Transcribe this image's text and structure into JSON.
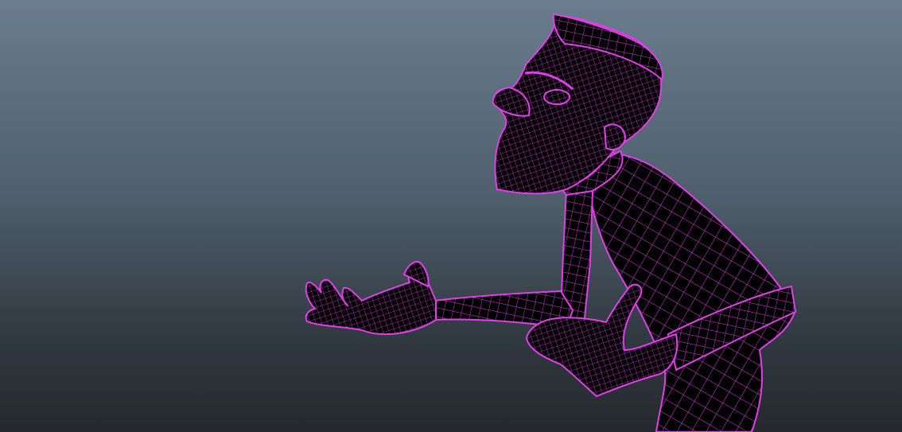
{
  "viewport": {
    "background_top": "#6a7d8e",
    "background_bottom": "#25292d",
    "wire_color": "#e040e8",
    "fill_color": "#000000",
    "display_mode": "wireframe-on-shaded"
  },
  "scene": {
    "subject": "character-mesh",
    "pose": "leaning-forward-gesturing"
  }
}
